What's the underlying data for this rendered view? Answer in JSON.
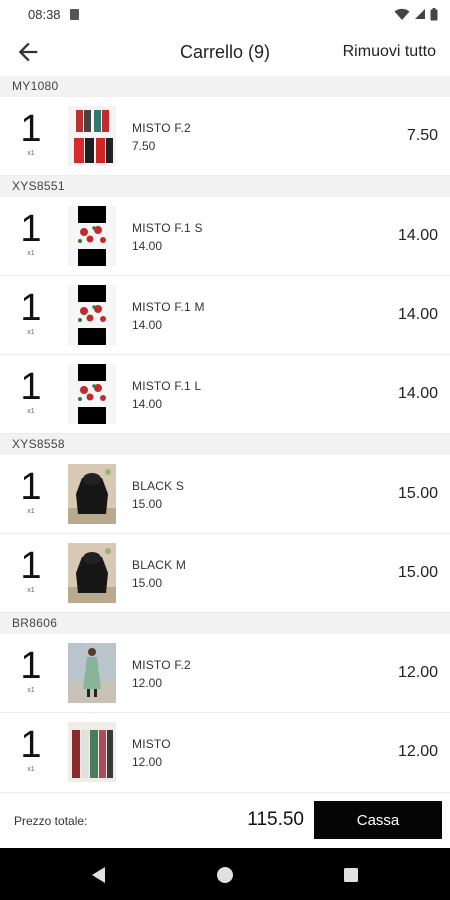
{
  "status_bar": {
    "time": "08:38"
  },
  "header": {
    "title": "Carrello (9)",
    "clear_label": "Rimuovi tutto"
  },
  "groups": [
    {
      "code": "MY1080",
      "items": [
        {
          "qty": "1",
          "qty_sub": "x1",
          "name": "MISTO F.2",
          "unit_price": "7.50",
          "price": "7.50",
          "thumb": "twin-dresses"
        }
      ]
    },
    {
      "code": "XYS8551",
      "items": [
        {
          "qty": "1",
          "qty_sub": "x1",
          "name": "MISTO F.1 S",
          "unit_price": "14.00",
          "price": "14.00",
          "thumb": "floral"
        },
        {
          "qty": "1",
          "qty_sub": "x1",
          "name": "MISTO F.1 M",
          "unit_price": "14.00",
          "price": "14.00",
          "thumb": "floral"
        },
        {
          "qty": "1",
          "qty_sub": "x1",
          "name": "MISTO F.1 L",
          "unit_price": "14.00",
          "price": "14.00",
          "thumb": "floral"
        }
      ]
    },
    {
      "code": "XYS8558",
      "items": [
        {
          "qty": "1",
          "qty_sub": "x1",
          "name": "BLACK S",
          "unit_price": "15.00",
          "price": "15.00",
          "thumb": "black-jacket"
        },
        {
          "qty": "1",
          "qty_sub": "x1",
          "name": "BLACK M",
          "unit_price": "15.00",
          "price": "15.00",
          "thumb": "black-jacket"
        }
      ]
    },
    {
      "code": "BR8606",
      "items": [
        {
          "qty": "1",
          "qty_sub": "x1",
          "name": "MISTO F.2",
          "unit_price": "12.00",
          "price": "12.00",
          "thumb": "green-dress"
        },
        {
          "qty": "1",
          "qty_sub": "x1",
          "name": "MISTO",
          "unit_price": "12.00",
          "price": "12.00",
          "thumb": "colored-dresses"
        }
      ]
    }
  ],
  "footer": {
    "total_label": "Prezzo totale:",
    "total_value": "115.50",
    "checkout_label": "Cassa"
  },
  "icons": {
    "back": "arrow-left-icon",
    "wifi": "wifi-icon",
    "signal": "signal-icon",
    "battery": "battery-icon",
    "nav_back": "nav-back-icon",
    "nav_home": "nav-home-icon",
    "nav_recents": "nav-recents-icon"
  },
  "colors": {
    "accent": "#050505",
    "group_bg": "#f2f2f2",
    "nav_bar": "#000000"
  }
}
